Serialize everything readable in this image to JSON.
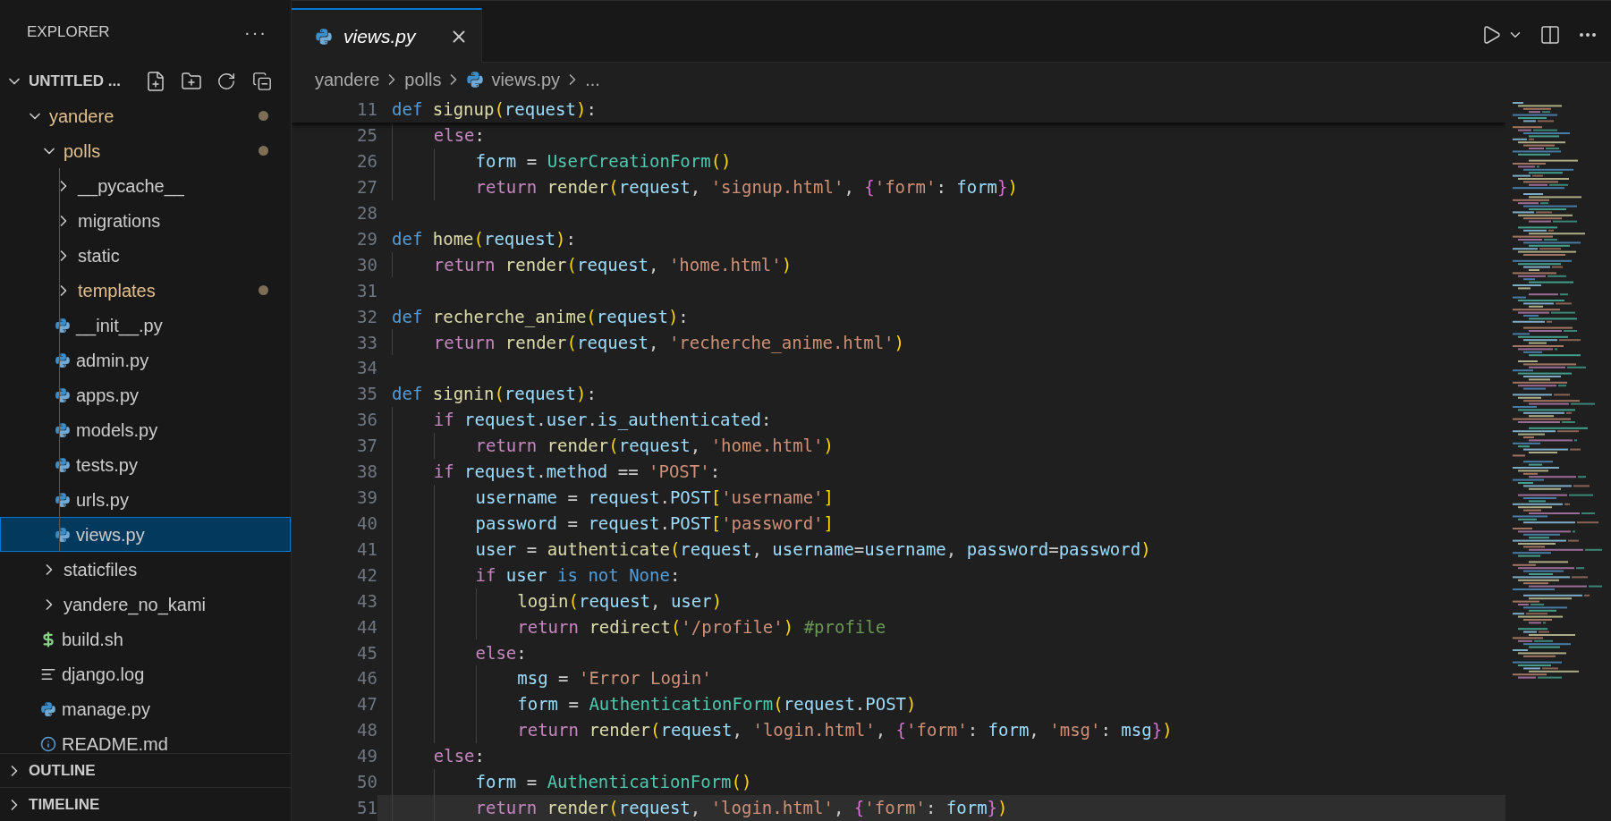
{
  "sidebar": {
    "title": "EXPLORER",
    "more": "···",
    "workspace": {
      "label": "UNTITLED ...",
      "expanded": true
    },
    "tree": [
      {
        "label": "yandere",
        "kind": "folder",
        "expanded": true,
        "modified": true,
        "selected": false,
        "children": [
          {
            "label": "polls",
            "kind": "folder",
            "expanded": true,
            "modified": true,
            "selected": false,
            "children": [
              {
                "label": "__pycache__",
                "kind": "folder",
                "expanded": false,
                "modified": false,
                "selected": false
              },
              {
                "label": "migrations",
                "kind": "folder",
                "expanded": false,
                "modified": false,
                "selected": false
              },
              {
                "label": "static",
                "kind": "folder",
                "expanded": false,
                "modified": false,
                "selected": false
              },
              {
                "label": "templates",
                "kind": "folder",
                "expanded": false,
                "modified": true,
                "selected": false
              },
              {
                "label": "__init__.py",
                "kind": "python",
                "modified": false,
                "selected": false
              },
              {
                "label": "admin.py",
                "kind": "python",
                "modified": false,
                "selected": false
              },
              {
                "label": "apps.py",
                "kind": "python",
                "modified": false,
                "selected": false
              },
              {
                "label": "models.py",
                "kind": "python",
                "modified": false,
                "selected": false
              },
              {
                "label": "tests.py",
                "kind": "python",
                "modified": false,
                "selected": false
              },
              {
                "label": "urls.py",
                "kind": "python",
                "modified": false,
                "selected": false
              },
              {
                "label": "views.py",
                "kind": "python",
                "modified": false,
                "selected": true
              }
            ]
          },
          {
            "label": "staticfiles",
            "kind": "folder",
            "expanded": false,
            "modified": false,
            "selected": false
          },
          {
            "label": "yandere_no_kami",
            "kind": "folder",
            "expanded": false,
            "modified": false,
            "selected": false
          },
          {
            "label": "build.sh",
            "kind": "shell",
            "modified": false,
            "selected": false
          },
          {
            "label": "django.log",
            "kind": "log",
            "modified": false,
            "selected": false
          },
          {
            "label": "manage.py",
            "kind": "python",
            "modified": false,
            "selected": false
          },
          {
            "label": "README.md",
            "kind": "info",
            "modified": false,
            "selected": false
          }
        ]
      }
    ],
    "panels": [
      {
        "label": "OUTLINE",
        "expanded": false
      },
      {
        "label": "TIMELINE",
        "expanded": false
      }
    ]
  },
  "tabs": [
    {
      "label": "views.py",
      "kind": "python",
      "selected": true,
      "preview": true
    }
  ],
  "breadcrumbs": [
    {
      "label": "yandere",
      "kind": "folder"
    },
    {
      "label": "polls",
      "kind": "folder"
    },
    {
      "label": "views.py",
      "kind": "python"
    },
    {
      "label": "...",
      "kind": "more"
    }
  ],
  "sticky_line": {
    "number": "11",
    "tokens": [
      {
        "text": "def",
        "kind": "keyword"
      },
      {
        "text": " signup",
        "kind": "function"
      },
      {
        "text": "(",
        "kind": "bracket1"
      },
      {
        "text": "request",
        "kind": "variable"
      },
      {
        "text": ")",
        "kind": "bracket1"
      },
      {
        "text": ":",
        "kind": "plain"
      }
    ]
  },
  "lines": [
    {
      "number": "25",
      "current": false,
      "tokens": [
        {
          "text": "    else",
          "kind": "control"
        },
        {
          "text": ":",
          "kind": "plain"
        }
      ]
    },
    {
      "number": "26",
      "current": false,
      "tokens": [
        {
          "text": "        form",
          "kind": "variable"
        },
        {
          "text": " = ",
          "kind": "plain"
        },
        {
          "text": "UserCreationForm",
          "kind": "class"
        },
        {
          "text": "()",
          "kind": "bracket1"
        }
      ]
    },
    {
      "number": "27",
      "current": false,
      "tokens": [
        {
          "text": "        return",
          "kind": "control"
        },
        {
          "text": " render",
          "kind": "function"
        },
        {
          "text": "(",
          "kind": "bracket1"
        },
        {
          "text": "request",
          "kind": "variable"
        },
        {
          "text": ", ",
          "kind": "plain"
        },
        {
          "text": "'signup.html'",
          "kind": "string"
        },
        {
          "text": ", ",
          "kind": "plain"
        },
        {
          "text": "{",
          "kind": "bracket2"
        },
        {
          "text": "'form'",
          "kind": "string"
        },
        {
          "text": ": ",
          "kind": "plain"
        },
        {
          "text": "form",
          "kind": "variable"
        },
        {
          "text": "}",
          "kind": "bracket2"
        },
        {
          "text": ")",
          "kind": "bracket1"
        }
      ]
    },
    {
      "number": "28",
      "current": false
    },
    {
      "number": "29",
      "current": false,
      "tokens": [
        {
          "text": "def",
          "kind": "keyword"
        },
        {
          "text": " home",
          "kind": "function"
        },
        {
          "text": "(",
          "kind": "bracket1"
        },
        {
          "text": "request",
          "kind": "variable"
        },
        {
          "text": ")",
          "kind": "bracket1"
        },
        {
          "text": ":",
          "kind": "plain"
        }
      ]
    },
    {
      "number": "30",
      "current": false,
      "tokens": [
        {
          "text": "    return",
          "kind": "control"
        },
        {
          "text": " render",
          "kind": "function"
        },
        {
          "text": "(",
          "kind": "bracket1"
        },
        {
          "text": "request",
          "kind": "variable"
        },
        {
          "text": ", ",
          "kind": "plain"
        },
        {
          "text": "'home.html'",
          "kind": "string"
        },
        {
          "text": ")",
          "kind": "bracket1"
        }
      ]
    },
    {
      "number": "31",
      "current": false
    },
    {
      "number": "32",
      "current": false,
      "tokens": [
        {
          "text": "def",
          "kind": "keyword"
        },
        {
          "text": " recherche_anime",
          "kind": "function"
        },
        {
          "text": "(",
          "kind": "bracket1"
        },
        {
          "text": "request",
          "kind": "variable"
        },
        {
          "text": ")",
          "kind": "bracket1"
        },
        {
          "text": ":",
          "kind": "plain"
        }
      ]
    },
    {
      "number": "33",
      "current": false,
      "tokens": [
        {
          "text": "    return",
          "kind": "control"
        },
        {
          "text": " render",
          "kind": "function"
        },
        {
          "text": "(",
          "kind": "bracket1"
        },
        {
          "text": "request",
          "kind": "variable"
        },
        {
          "text": ", ",
          "kind": "plain"
        },
        {
          "text": "'recherche_anime.html'",
          "kind": "string"
        },
        {
          "text": ")",
          "kind": "bracket1"
        }
      ]
    },
    {
      "number": "34",
      "current": false
    },
    {
      "number": "35",
      "current": false,
      "tokens": [
        {
          "text": "def",
          "kind": "keyword"
        },
        {
          "text": " signin",
          "kind": "function"
        },
        {
          "text": "(",
          "kind": "bracket1"
        },
        {
          "text": "request",
          "kind": "variable"
        },
        {
          "text": ")",
          "kind": "bracket1"
        },
        {
          "text": ":",
          "kind": "plain"
        }
      ]
    },
    {
      "number": "36",
      "current": false,
      "tokens": [
        {
          "text": "    if",
          "kind": "control"
        },
        {
          "text": " request",
          "kind": "variable"
        },
        {
          "text": ".",
          "kind": "plain"
        },
        {
          "text": "user",
          "kind": "variable"
        },
        {
          "text": ".",
          "kind": "plain"
        },
        {
          "text": "is_authenticated",
          "kind": "variable"
        },
        {
          "text": ":",
          "kind": "plain"
        }
      ]
    },
    {
      "number": "37",
      "current": false,
      "tokens": [
        {
          "text": "        return",
          "kind": "control"
        },
        {
          "text": " render",
          "kind": "function"
        },
        {
          "text": "(",
          "kind": "bracket1"
        },
        {
          "text": "request",
          "kind": "variable"
        },
        {
          "text": ", ",
          "kind": "plain"
        },
        {
          "text": "'home.html'",
          "kind": "string"
        },
        {
          "text": ")",
          "kind": "bracket1"
        }
      ]
    },
    {
      "number": "38",
      "current": false,
      "tokens": [
        {
          "text": "    if",
          "kind": "control"
        },
        {
          "text": " request",
          "kind": "variable"
        },
        {
          "text": ".",
          "kind": "plain"
        },
        {
          "text": "method",
          "kind": "variable"
        },
        {
          "text": " == ",
          "kind": "plain"
        },
        {
          "text": "'POST'",
          "kind": "string"
        },
        {
          "text": ":",
          "kind": "plain"
        }
      ]
    },
    {
      "number": "39",
      "current": false,
      "tokens": [
        {
          "text": "        username",
          "kind": "variable"
        },
        {
          "text": " = ",
          "kind": "plain"
        },
        {
          "text": "request",
          "kind": "variable"
        },
        {
          "text": ".",
          "kind": "plain"
        },
        {
          "text": "POST",
          "kind": "variable"
        },
        {
          "text": "[",
          "kind": "bracket1"
        },
        {
          "text": "'username'",
          "kind": "string"
        },
        {
          "text": "]",
          "kind": "bracket1"
        }
      ]
    },
    {
      "number": "40",
      "current": false,
      "tokens": [
        {
          "text": "        password",
          "kind": "variable"
        },
        {
          "text": " = ",
          "kind": "plain"
        },
        {
          "text": "request",
          "kind": "variable"
        },
        {
          "text": ".",
          "kind": "plain"
        },
        {
          "text": "POST",
          "kind": "variable"
        },
        {
          "text": "[",
          "kind": "bracket1"
        },
        {
          "text": "'password'",
          "kind": "string"
        },
        {
          "text": "]",
          "kind": "bracket1"
        }
      ]
    },
    {
      "number": "41",
      "current": false,
      "tokens": [
        {
          "text": "        user",
          "kind": "variable"
        },
        {
          "text": " = ",
          "kind": "plain"
        },
        {
          "text": "authenticate",
          "kind": "function"
        },
        {
          "text": "(",
          "kind": "bracket1"
        },
        {
          "text": "request",
          "kind": "variable"
        },
        {
          "text": ", ",
          "kind": "plain"
        },
        {
          "text": "username",
          "kind": "variable"
        },
        {
          "text": "=",
          "kind": "plain"
        },
        {
          "text": "username",
          "kind": "variable"
        },
        {
          "text": ", ",
          "kind": "plain"
        },
        {
          "text": "password",
          "kind": "variable"
        },
        {
          "text": "=",
          "kind": "plain"
        },
        {
          "text": "password",
          "kind": "variable"
        },
        {
          "text": ")",
          "kind": "bracket1"
        }
      ]
    },
    {
      "number": "42",
      "current": false,
      "tokens": [
        {
          "text": "        if",
          "kind": "control"
        },
        {
          "text": " user",
          "kind": "variable"
        },
        {
          "text": " is not None",
          "kind": "keyword"
        },
        {
          "text": ":",
          "kind": "plain"
        }
      ]
    },
    {
      "number": "43",
      "current": false,
      "tokens": [
        {
          "text": "            login",
          "kind": "function"
        },
        {
          "text": "(",
          "kind": "bracket1"
        },
        {
          "text": "request",
          "kind": "variable"
        },
        {
          "text": ", ",
          "kind": "plain"
        },
        {
          "text": "user",
          "kind": "variable"
        },
        {
          "text": ")",
          "kind": "bracket1"
        }
      ]
    },
    {
      "number": "44",
      "current": false,
      "tokens": [
        {
          "text": "            return",
          "kind": "control"
        },
        {
          "text": " redirect",
          "kind": "function"
        },
        {
          "text": "(",
          "kind": "bracket1"
        },
        {
          "text": "'/profile'",
          "kind": "string"
        },
        {
          "text": ")",
          "kind": "bracket1"
        },
        {
          "text": " #profile",
          "kind": "comment"
        }
      ]
    },
    {
      "number": "45",
      "current": false,
      "tokens": [
        {
          "text": "        else",
          "kind": "control"
        },
        {
          "text": ":",
          "kind": "plain"
        }
      ]
    },
    {
      "number": "46",
      "current": false,
      "tokens": [
        {
          "text": "            msg",
          "kind": "variable"
        },
        {
          "text": " = ",
          "kind": "plain"
        },
        {
          "text": "'Error Login'",
          "kind": "string"
        }
      ]
    },
    {
      "number": "47",
      "current": false,
      "tokens": [
        {
          "text": "            form",
          "kind": "variable"
        },
        {
          "text": " = ",
          "kind": "plain"
        },
        {
          "text": "AuthenticationForm",
          "kind": "class"
        },
        {
          "text": "(",
          "kind": "bracket1"
        },
        {
          "text": "request",
          "kind": "variable"
        },
        {
          "text": ".",
          "kind": "plain"
        },
        {
          "text": "POST",
          "kind": "variable"
        },
        {
          "text": ")",
          "kind": "bracket1"
        }
      ]
    },
    {
      "number": "48",
      "current": false,
      "tokens": [
        {
          "text": "            return",
          "kind": "control"
        },
        {
          "text": " render",
          "kind": "function"
        },
        {
          "text": "(",
          "kind": "bracket1"
        },
        {
          "text": "request",
          "kind": "variable"
        },
        {
          "text": ", ",
          "kind": "plain"
        },
        {
          "text": "'login.html'",
          "kind": "string"
        },
        {
          "text": ", ",
          "kind": "plain"
        },
        {
          "text": "{",
          "kind": "bracket2"
        },
        {
          "text": "'form'",
          "kind": "string"
        },
        {
          "text": ": ",
          "kind": "plain"
        },
        {
          "text": "form",
          "kind": "variable"
        },
        {
          "text": ", ",
          "kind": "plain"
        },
        {
          "text": "'msg'",
          "kind": "string"
        },
        {
          "text": ": ",
          "kind": "plain"
        },
        {
          "text": "msg",
          "kind": "variable"
        },
        {
          "text": "}",
          "kind": "bracket2"
        },
        {
          "text": ")",
          "kind": "bracket1"
        }
      ]
    },
    {
      "number": "49",
      "current": false,
      "tokens": [
        {
          "text": "    else",
          "kind": "control"
        },
        {
          "text": ":",
          "kind": "plain"
        }
      ]
    },
    {
      "number": "50",
      "current": false,
      "tokens": [
        {
          "text": "        form",
          "kind": "variable"
        },
        {
          "text": " = ",
          "kind": "plain"
        },
        {
          "text": "AuthenticationForm",
          "kind": "class"
        },
        {
          "text": "()",
          "kind": "bracket1"
        }
      ]
    },
    {
      "number": "51",
      "current": true,
      "tokens": [
        {
          "text": "        return",
          "kind": "control"
        },
        {
          "text": " render",
          "kind": "function"
        },
        {
          "text": "(",
          "kind": "bracket1"
        },
        {
          "text": "request",
          "kind": "variable"
        },
        {
          "text": ", ",
          "kind": "plain"
        },
        {
          "text": "'login.html'",
          "kind": "string"
        },
        {
          "text": ", ",
          "kind": "plain"
        },
        {
          "text": "{",
          "kind": "bracket2"
        },
        {
          "text": "'form'",
          "kind": "string"
        },
        {
          "text": ": ",
          "kind": "plain"
        },
        {
          "text": "form",
          "kind": "variable"
        },
        {
          "text": "}",
          "kind": "bracket2"
        },
        {
          "text": ")",
          "kind": "bracket1"
        }
      ]
    }
  ]
}
